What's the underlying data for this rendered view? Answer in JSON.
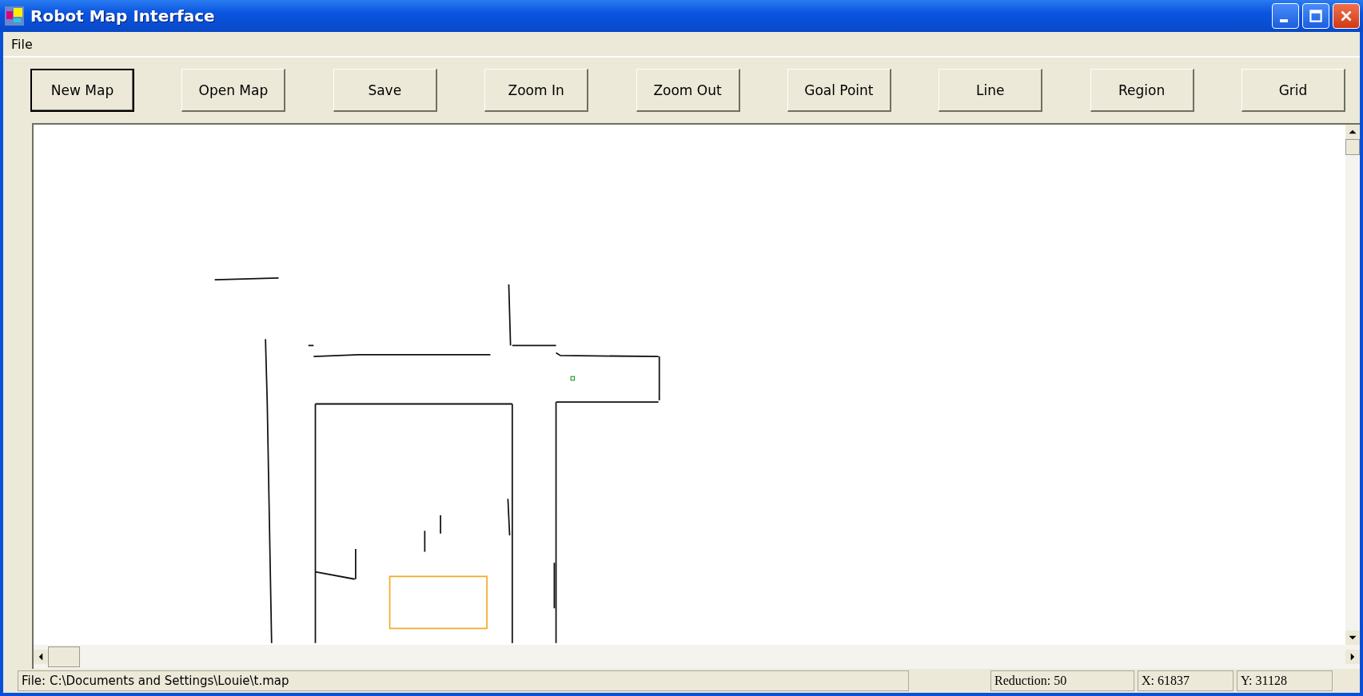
{
  "window": {
    "title": "Robot Map Interface"
  },
  "menu": [
    "File"
  ],
  "toolbar": [
    {
      "label": "New Map",
      "focused": true
    },
    {
      "label": "Open Map",
      "focused": false
    },
    {
      "label": "Save",
      "focused": false
    },
    {
      "label": "Zoom In",
      "focused": false
    },
    {
      "label": "Zoom Out",
      "focused": false
    },
    {
      "label": "Goal Point",
      "focused": false
    },
    {
      "label": "Line",
      "focused": false
    },
    {
      "label": "Region",
      "focused": false
    },
    {
      "label": "Grid",
      "focused": false
    }
  ],
  "status_bar": {
    "file": "File: C:\\Documents and Settings\\Louie\\t.map",
    "reduction": "Reduction: 50",
    "x": "X: 61837",
    "y": "Y: 31128"
  }
}
